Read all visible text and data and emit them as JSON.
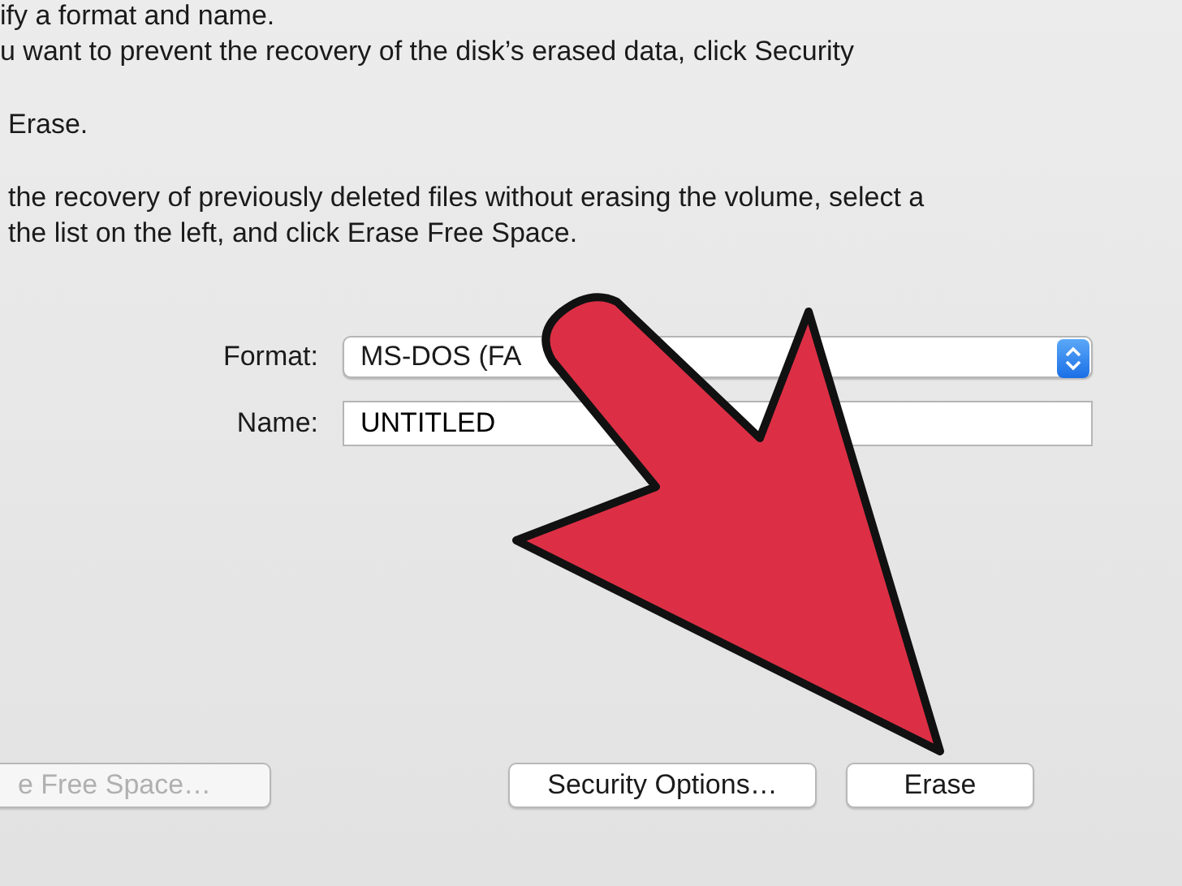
{
  "instructions": [
    {
      "lines": [
        "ify a format and name.",
        "u want to prevent the recovery of the disk’s erased data, click Security"
      ]
    },
    {
      "lines": [
        "Erase."
      ]
    },
    {
      "lines": [
        "the recovery of previously deleted files without erasing the volume, select a",
        "the list on the left, and click Erase Free Space."
      ]
    }
  ],
  "fields": [
    {
      "kind": "popup",
      "label": "Format:",
      "value": "MS-DOS (FA"
    },
    {
      "kind": "text",
      "label": "Name:",
      "value": "UNTITLED"
    }
  ],
  "buttons": [
    {
      "label": "e Free Space…",
      "disabled": true
    },
    {
      "label": "Security Options…",
      "disabled": false
    },
    {
      "label": "Erase",
      "disabled": false
    }
  ],
  "annotation": {
    "kind": "arrow"
  }
}
